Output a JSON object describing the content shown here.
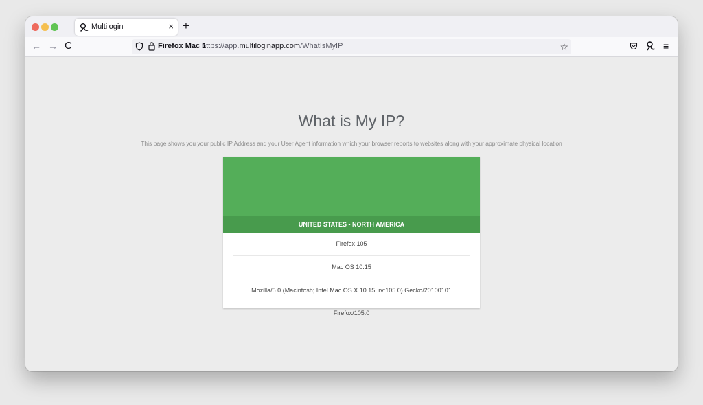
{
  "tab": {
    "title": "Multilogin",
    "close": "×",
    "new_tab": "+"
  },
  "navbar": {
    "back": "←",
    "forward": "→",
    "reload": "C",
    "container_label": "Firefox Mac 1",
    "url_prefix": "https://app.",
    "url_domain": "multiloginapp.com",
    "url_path": "/WhatIsMyIP",
    "star": "☆",
    "menu": "≡"
  },
  "page": {
    "title": "What is My IP?",
    "subtitle": "This page shows you your public IP Address and your User Agent information which your browser reports to websites along with your approximate physical location"
  },
  "card": {
    "region": "UNITED STATES - NORTH AMERICA",
    "browser": "Firefox 105",
    "os": "Mac OS 10.15",
    "user_agent": "Mozilla/5.0 (Macintosh; Intel Mac OS X 10.15; rv:105.0) Gecko/20100101 Firefox/105.0"
  },
  "colors": {
    "map_green": "#54ae59",
    "region_bar_green": "#489b4d",
    "traffic_red": "#ee6a5e",
    "traffic_yellow": "#f5bf4f",
    "traffic_green": "#61c454"
  },
  "icons": {
    "tab_icon": "multilogin-logo-icon",
    "shield": "tracking-protection-shield-icon",
    "lock": "lock-icon",
    "pocket": "pocket-icon",
    "account": "multilogin-account-icon"
  }
}
